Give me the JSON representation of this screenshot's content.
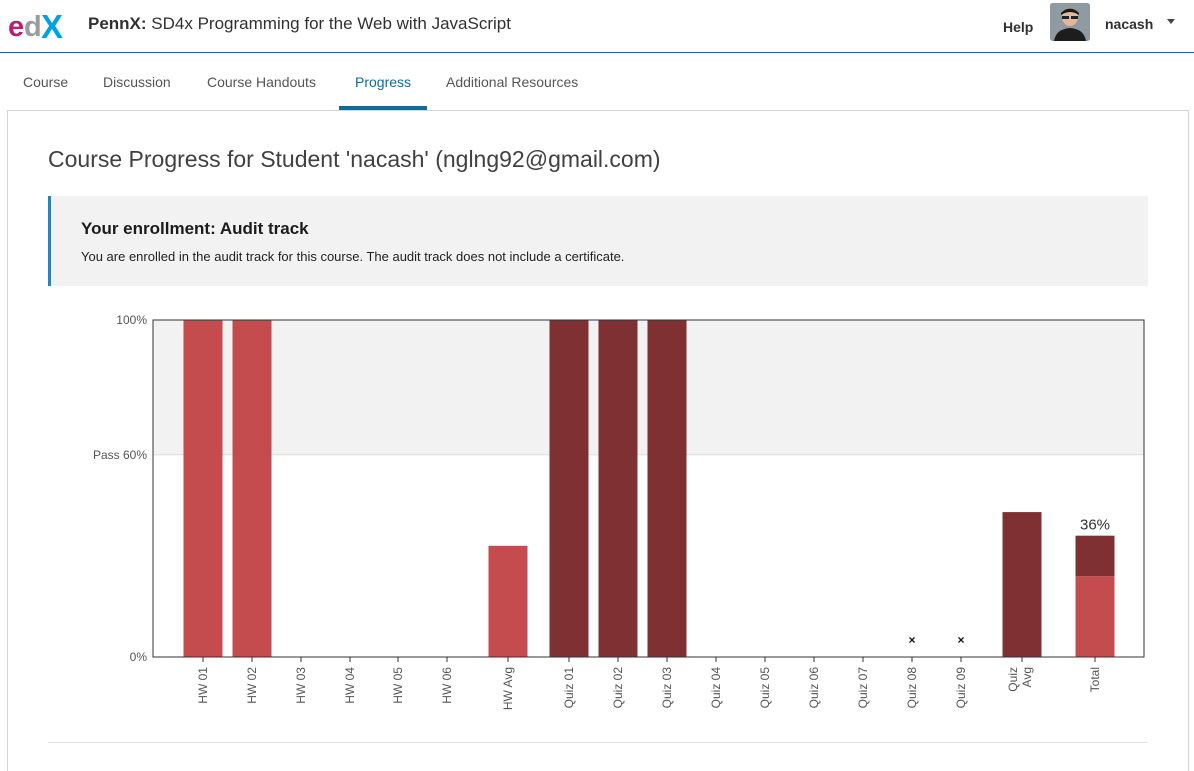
{
  "header": {
    "logo": "edX",
    "course_org": "PennX:",
    "course_name": "SD4x Programming for the Web with JavaScript",
    "help_label": "Help",
    "username": "nacash"
  },
  "tabs": [
    {
      "label": "Course"
    },
    {
      "label": "Discussion"
    },
    {
      "label": "Course Handouts"
    },
    {
      "label": "Progress",
      "active": true
    },
    {
      "label": "Additional Resources"
    }
  ],
  "main": {
    "title": "Course Progress for Student 'nacash' (nglng92@gmail.com)",
    "enrollment": {
      "title": "Your enrollment: Audit track",
      "text": "You are enrolled in the audit track for this course. The audit track does not include a certificate."
    }
  },
  "colors": {
    "homework": "#c44c4f",
    "quiz": "#7f3033",
    "pass_zone": "#f2f2f2",
    "accent": "#0e6b9c"
  },
  "chart_data": {
    "type": "bar",
    "ytick_labels": [
      "0%",
      "Pass 60%",
      "100%"
    ],
    "ylim": [
      0,
      100
    ],
    "pass_threshold": 60,
    "categories": [
      "HW 01",
      "HW 02",
      "HW 03",
      "HW 04",
      "HW 05",
      "HW 06",
      "HW Avg",
      "Quiz 01",
      "Quiz 02",
      "Quiz 03",
      "Quiz 04",
      "Quiz 05",
      "Quiz 06",
      "Quiz 07",
      "Quiz 08",
      "Quiz 09",
      "Quiz Avg",
      "Total"
    ],
    "values": [
      100,
      100,
      0,
      0,
      0,
      0,
      33,
      100,
      100,
      100,
      0,
      0,
      0,
      0,
      0,
      0,
      43,
      36
    ],
    "kinds": [
      "hw",
      "hw",
      "hw",
      "hw",
      "hw",
      "hw",
      "hw",
      "quiz",
      "quiz",
      "quiz",
      "quiz",
      "quiz",
      "quiz",
      "quiz",
      "quiz",
      "quiz",
      "quiz",
      "total"
    ],
    "dropped": [
      false,
      false,
      false,
      false,
      false,
      false,
      false,
      false,
      false,
      false,
      false,
      false,
      false,
      false,
      true,
      true,
      false,
      false
    ],
    "total_breakdown": {
      "hw": 24,
      "quiz": 12
    },
    "total_label": "36%",
    "dropped_marker": "×"
  }
}
